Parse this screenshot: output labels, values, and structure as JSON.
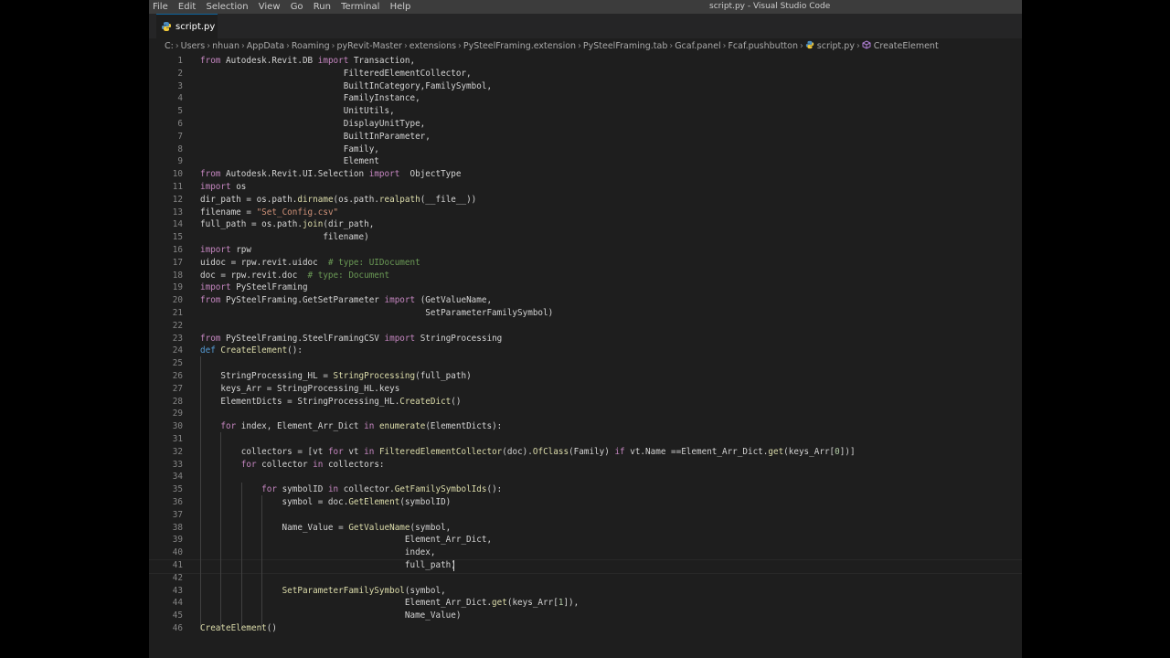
{
  "menu": [
    "File",
    "Edit",
    "Selection",
    "View",
    "Go",
    "Run",
    "Terminal",
    "Help"
  ],
  "window_title": "script.py - Visual Studio Code",
  "tab": {
    "label": "script.py",
    "icon": "python-file-icon"
  },
  "breadcrumb": [
    "C:",
    "Users",
    "nhuan",
    "AppData",
    "Roaming",
    "pyRevit-Master",
    "extensions",
    "PySteelFraming.extension",
    "PySteelFraming.tab",
    "Gcaf.panel",
    "Fcaf.pushbutton",
    "script.py",
    "CreateElement"
  ],
  "colors": {
    "background": "#1e1e1e",
    "keyword": "#c586c0",
    "string": "#ce9178",
    "comment": "#6a9955",
    "function": "#dcdcaa"
  },
  "code_lines": [
    "from Autodesk.Revit.DB import Transaction,",
    "                            FilteredElementCollector,",
    "                            BuiltInCategory,FamilySymbol,",
    "                            FamilyInstance,",
    "                            UnitUtils,",
    "                            DisplayUnitType,",
    "                            BuiltInParameter,",
    "                            Family,",
    "                            Element",
    "from Autodesk.Revit.UI.Selection import  ObjectType",
    "import os",
    "dir_path = os.path.dirname(os.path.realpath(__file__))",
    "filename = \"Set_Config.csv\"",
    "full_path = os.path.join(dir_path,",
    "                        filename)",
    "import rpw",
    "uidoc = rpw.revit.uidoc  # type: UIDocument",
    "doc = rpw.revit.doc  # type: Document",
    "import PySteelFraming",
    "from PySteelFraming.GetSetParameter import (GetValueName,",
    "                                            SetParameterFamilySymbol)",
    "",
    "from PySteelFraming.SteelFramingCSV import StringProcessing",
    "def CreateElement():",
    "",
    "    StringProcessing_HL = StringProcessing(full_path)",
    "    keys_Arr = StringProcessing_HL.keys",
    "    ElementDicts = StringProcessing_HL.CreateDict()",
    "",
    "    for index, Element_Arr_Dict in enumerate(ElementDicts):",
    "",
    "        collectors = [vt for vt in FilteredElementCollector(doc).OfClass(Family) if vt.Name ==Element_Arr_Dict.get(keys_Arr[0])]",
    "        for collector in collectors:",
    "",
    "            for symbolID in collector.GetFamilySymbolIds():",
    "                symbol = doc.GetElement(symbolID)",
    "",
    "                Name_Value = GetValueName(symbol,",
    "                                        Element_Arr_Dict,",
    "                                        index,",
    "                                        full_path)",
    "",
    "                SetParameterFamilySymbol(symbol,",
    "                                        Element_Arr_Dict.get(keys_Arr[1]),",
    "                                        Name_Value)",
    "CreateElement()"
  ]
}
